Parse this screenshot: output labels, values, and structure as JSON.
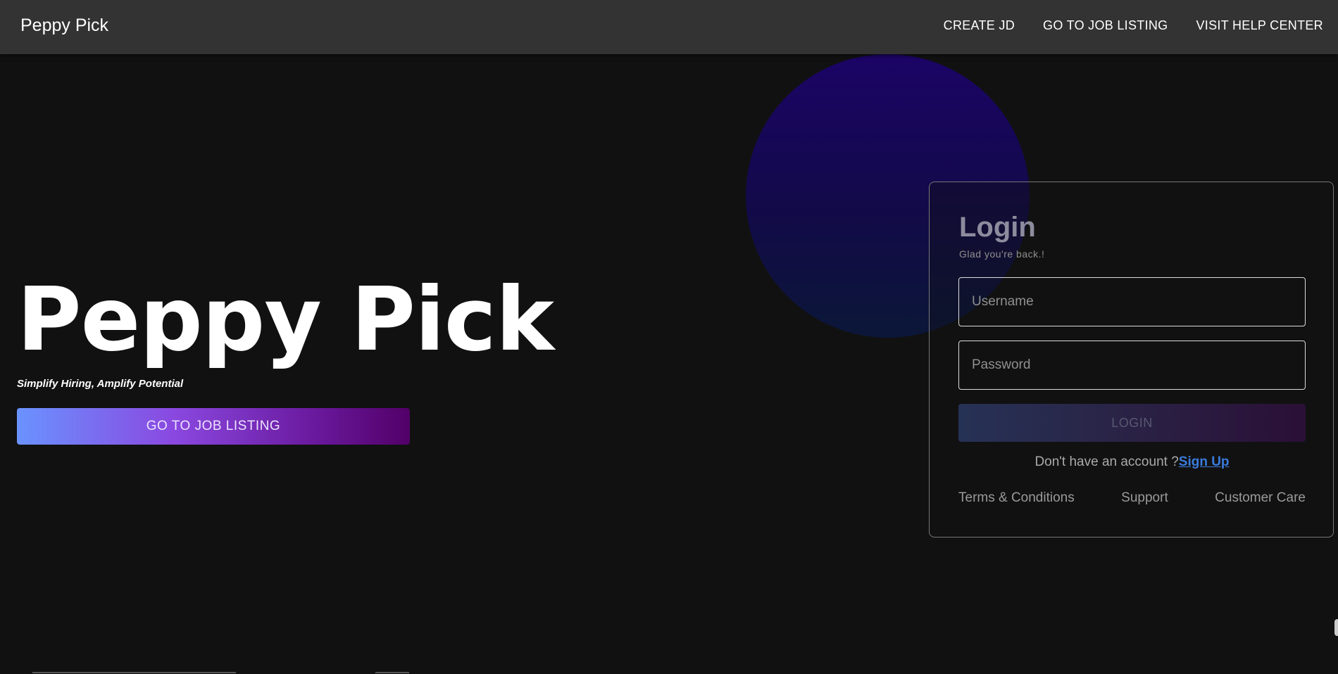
{
  "navbar": {
    "brand": "Peppy Pick",
    "links": [
      "CREATE JD",
      "GO TO JOB LISTING",
      "VISIT HELP CENTER"
    ]
  },
  "hero": {
    "title": "Peppy Pick",
    "tagline": "Simplify Hiring, Amplify Potential",
    "button_label": "GO TO JOB LISTING"
  },
  "login": {
    "title": "Login",
    "subtitle": "Glad you're back.!",
    "username_placeholder": "Username",
    "password_placeholder": "Password",
    "button_label": "LOGIN",
    "signup_prompt": "Don't have an account ?",
    "signup_link": "Sign Up",
    "footer_links": [
      "Terms & Conditions",
      "Support",
      "Customer Care"
    ]
  },
  "colors": {
    "background": "#111111",
    "navbar": "#333333",
    "accent_link": "#3a7bdc",
    "circle_top": "#1b0466",
    "button_gradient_start": "#6a93ff",
    "button_gradient_end": "#520068"
  }
}
